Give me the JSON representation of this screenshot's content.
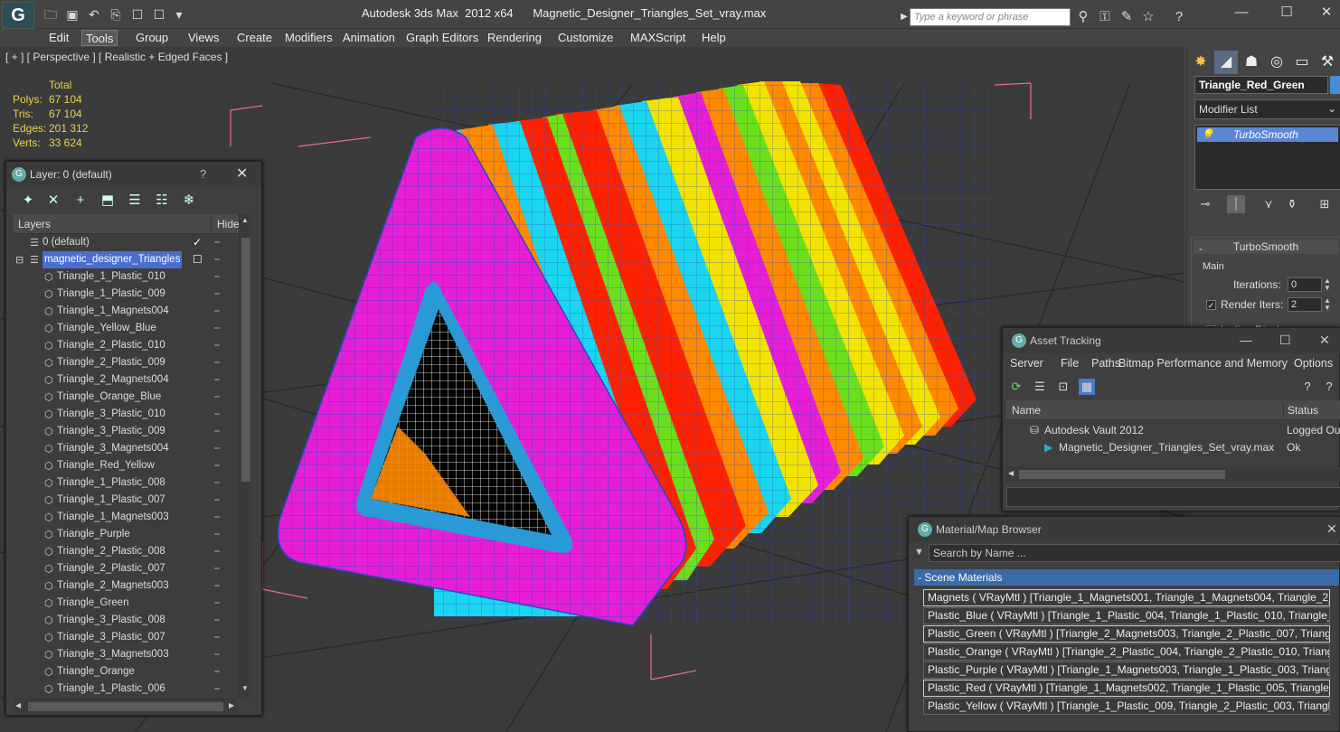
{
  "app": {
    "logo": "G",
    "title": "Autodesk 3ds Max  2012 x64      Magnetic_Designer_Triangles_Set_vray.max",
    "search_placeholder": "Type a keyword or phrase",
    "minimize": "—",
    "maximize": "☐",
    "close": "✕"
  },
  "menu": [
    "Edit",
    "Tools",
    "Group",
    "Views",
    "Create",
    "Modifiers",
    "Animation",
    "Graph Editors",
    "Rendering",
    "Customize",
    "MAXScript",
    "Help"
  ],
  "viewport": {
    "label": "[ + ] [ Perspective ] [ Realistic + Edged Faces ]",
    "stats_header": "Total",
    "stats": [
      {
        "key": "Polys:",
        "value": "67 104"
      },
      {
        "key": "Tris:",
        "value": "67 104"
      },
      {
        "key": "Edges:",
        "value": "201 312"
      },
      {
        "key": "Verts:",
        "value": "33 624"
      }
    ]
  },
  "layer_panel": {
    "title": "Layer: 0 (default)",
    "help": "?",
    "close": "✕",
    "col_layers": "Layers",
    "col_hide": "Hide",
    "rows": [
      {
        "label": "0 (default)",
        "level": 0,
        "checked": true,
        "selected": false
      },
      {
        "label": "magnetic_designer_Triangles",
        "level": 0,
        "checked": false,
        "selected": true
      },
      {
        "label": "Triangle_1_Plastic_010",
        "level": 1
      },
      {
        "label": "Triangle_1_Plastic_009",
        "level": 1
      },
      {
        "label": "Triangle_1_Magnets004",
        "level": 1
      },
      {
        "label": "Triangle_Yellow_Blue",
        "level": 1
      },
      {
        "label": "Triangle_2_Plastic_010",
        "level": 1
      },
      {
        "label": "Triangle_2_Plastic_009",
        "level": 1
      },
      {
        "label": "Triangle_2_Magnets004",
        "level": 1
      },
      {
        "label": "Triangle_Orange_Blue",
        "level": 1
      },
      {
        "label": "Triangle_3_Plastic_010",
        "level": 1
      },
      {
        "label": "Triangle_3_Plastic_009",
        "level": 1
      },
      {
        "label": "Triangle_3_Magnets004",
        "level": 1
      },
      {
        "label": "Triangle_Red_Yellow",
        "level": 1
      },
      {
        "label": "Triangle_1_Plastic_008",
        "level": 1
      },
      {
        "label": "Triangle_1_Plastic_007",
        "level": 1
      },
      {
        "label": "Triangle_1_Magnets003",
        "level": 1
      },
      {
        "label": "Triangle_Purple",
        "level": 1
      },
      {
        "label": "Triangle_2_Plastic_008",
        "level": 1
      },
      {
        "label": "Triangle_2_Plastic_007",
        "level": 1
      },
      {
        "label": "Triangle_2_Magnets003",
        "level": 1
      },
      {
        "label": "Triangle_Green",
        "level": 1
      },
      {
        "label": "Triangle_3_Plastic_008",
        "level": 1
      },
      {
        "label": "Triangle_3_Plastic_007",
        "level": 1
      },
      {
        "label": "Triangle_3_Magnets003",
        "level": 1
      },
      {
        "label": "Triangle_Orange",
        "level": 1
      },
      {
        "label": "Triangle_1_Plastic_006",
        "level": 1
      }
    ]
  },
  "command_panel": {
    "object_name": "Triangle_Red_Green",
    "object_color": "#4a8bd6",
    "modifier_list": "Modifier List",
    "stack_item": "TurboSmooth",
    "rollout_title": "TurboSmooth",
    "main_label": "Main",
    "iterations_label": "Iterations:",
    "iterations_value": "0",
    "render_iters_label": "Render Iters:",
    "render_iters_value": "2",
    "isoline_label": "Isoline Display"
  },
  "asset_tracking": {
    "title": "Asset Tracking",
    "menu": [
      "Server",
      "File",
      "Paths",
      "Bitmap Performance and Memory",
      "Options"
    ],
    "col_name": "Name",
    "col_status": "Status",
    "rows": [
      {
        "name": "Autodesk Vault 2012",
        "status": "Logged Out",
        "indent": 1
      },
      {
        "name": "Magnetic_Designer_Triangles_Set_vray.max",
        "status": "Ok",
        "indent": 2
      }
    ]
  },
  "material_browser": {
    "title": "Material/Map Browser",
    "search_placeholder": "Search by Name ...",
    "group": "- Scene Materials",
    "rows": [
      "Magnets  ( VRayMtl ) [Triangle_1_Magnets001, Triangle_1_Magnets004, Triangle_2_...",
      "Plastic_Blue  ( VRayMtl ) [Triangle_1_Plastic_004, Triangle_1_Plastic_010, Triangle_2...",
      "Plastic_Green  ( VRayMtl ) [Triangle_2_Magnets003, Triangle_2_Plastic_007, Triangle...",
      "Plastic_Orange  ( VRayMtl ) [Triangle_2_Plastic_004, Triangle_2_Plastic_010, Triangl...",
      "Plastic_Purple  ( VRayMtl ) [Triangle_1_Magnets003, Triangle_1_Plastic_003, Triangle...",
      "Plastic_Red  ( VRayMtl ) [Triangle_1_Magnets002, Triangle_1_Plastic_005, Triangle_1...",
      "Plastic_Yellow  ( VRayMtl ) [Triangle_1_Plastic_009, Triangle_2_Plastic_003, Triangle..."
    ]
  },
  "colors": {
    "magenta": "#e61fd6",
    "orange": "#ff8a00",
    "red": "#ff2200",
    "cyan": "#1ad6ee",
    "yellow": "#f2e400",
    "green": "#6cdf1c",
    "wire": "#2e44c8",
    "selection": "#4a6ed0"
  }
}
